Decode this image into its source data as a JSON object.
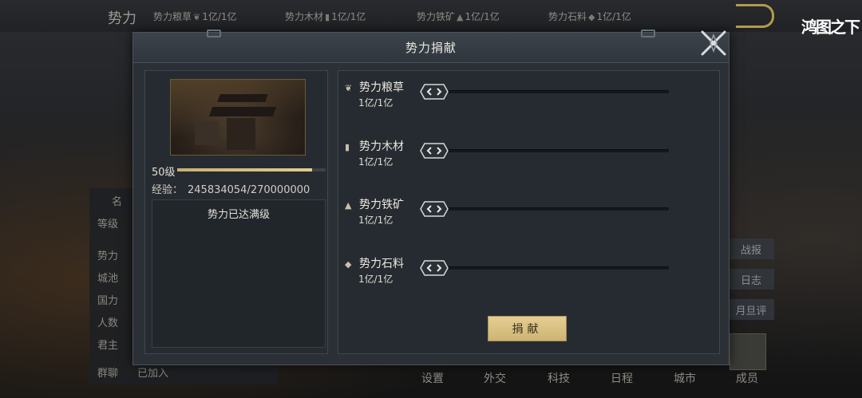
{
  "background": {
    "title": "势力",
    "top_resources": [
      {
        "name": "势力粮草",
        "icon": "grain-icon",
        "amount": "1亿/1亿"
      },
      {
        "name": "势力木材",
        "icon": "wood-icon",
        "amount": "1亿/1亿"
      },
      {
        "name": "势力铁矿",
        "icon": "iron-icon",
        "amount": "1亿/1亿"
      },
      {
        "name": "势力石料",
        "icon": "stone-icon",
        "amount": "1亿/1亿"
      }
    ],
    "brand": "鸿图之下",
    "left_rows": [
      "等级",
      "势力",
      "城池",
      "国力",
      "人数",
      "君主",
      "群聊"
    ],
    "left_partial_label": "名",
    "chat_status": "已加入",
    "right_buttons": [
      "战报",
      "日志",
      "月旦评"
    ],
    "bottom_nav": [
      "设置",
      "外交",
      "科技",
      "日程",
      "城市",
      "成员"
    ]
  },
  "dialog": {
    "title": "势力捐献",
    "level": {
      "label": "50级",
      "progress_fraction": 0.91
    },
    "experience": {
      "label": "经验：",
      "value": "245834054/270000000"
    },
    "status": "势力已达满级",
    "resources": [
      {
        "name": "势力粮草",
        "icon": "grain-icon",
        "amount": "1亿/1亿"
      },
      {
        "name": "势力木材",
        "icon": "wood-icon",
        "amount": "1亿/1亿"
      },
      {
        "name": "势力铁矿",
        "icon": "iron-icon",
        "amount": "1亿/1亿"
      },
      {
        "name": "势力石料",
        "icon": "stone-icon",
        "amount": "1亿/1亿"
      }
    ],
    "donate_button": "捐献"
  },
  "colors": {
    "accent_gold": "#d8c184",
    "panel_dark": "#262b31"
  }
}
